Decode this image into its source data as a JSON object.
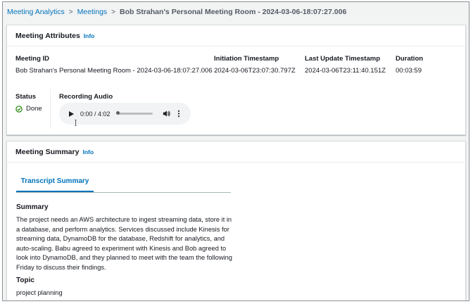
{
  "breadcrumb": {
    "items": [
      "Meeting Analytics",
      "Meetings"
    ],
    "current": "Bob Strahan's Personal Meeting Room - 2024-03-06-18:07:27.006"
  },
  "attributes": {
    "title": "Meeting Attributes",
    "info": "Info",
    "meeting_id": {
      "label": "Meeting ID",
      "value": "Bob Strahan's Personal Meeting Room - 2024-03-06-18:07:27.006"
    },
    "initiation": {
      "label": "Initiation Timestamp",
      "value": "2024-03-06T23:07:30.797Z"
    },
    "last_update": {
      "label": "Last Update Timestamp",
      "value": "2024-03-06T23:11:40.151Z"
    },
    "duration": {
      "label": "Duration",
      "value": "00:03:59"
    },
    "status": {
      "label": "Status",
      "value": "Done"
    },
    "recording": {
      "label": "Recording Audio",
      "time": "0:00 / 4:02",
      "progress": 0
    }
  },
  "summary": {
    "title": "Meeting Summary",
    "info": "Info",
    "tab": "Transcript Summary",
    "heading": "Summary",
    "text": "The project needs an AWS architecture to ingest streaming data, store it in a database, and perform analytics. Services discussed include Kinesis for streaming data, DynamoDB for the database, Redshift for analytics, and auto-scaling. Babu agreed to experiment with Kinesis and Bob agreed to look into DynamoDB, and they planned to meet with the team the following Friday to discuss their findings.",
    "topic_heading": "Topic",
    "topic": "project planning"
  },
  "colors": {
    "link": "#0073bb",
    "success": "#1d8102",
    "border": "#d5dbdb"
  }
}
